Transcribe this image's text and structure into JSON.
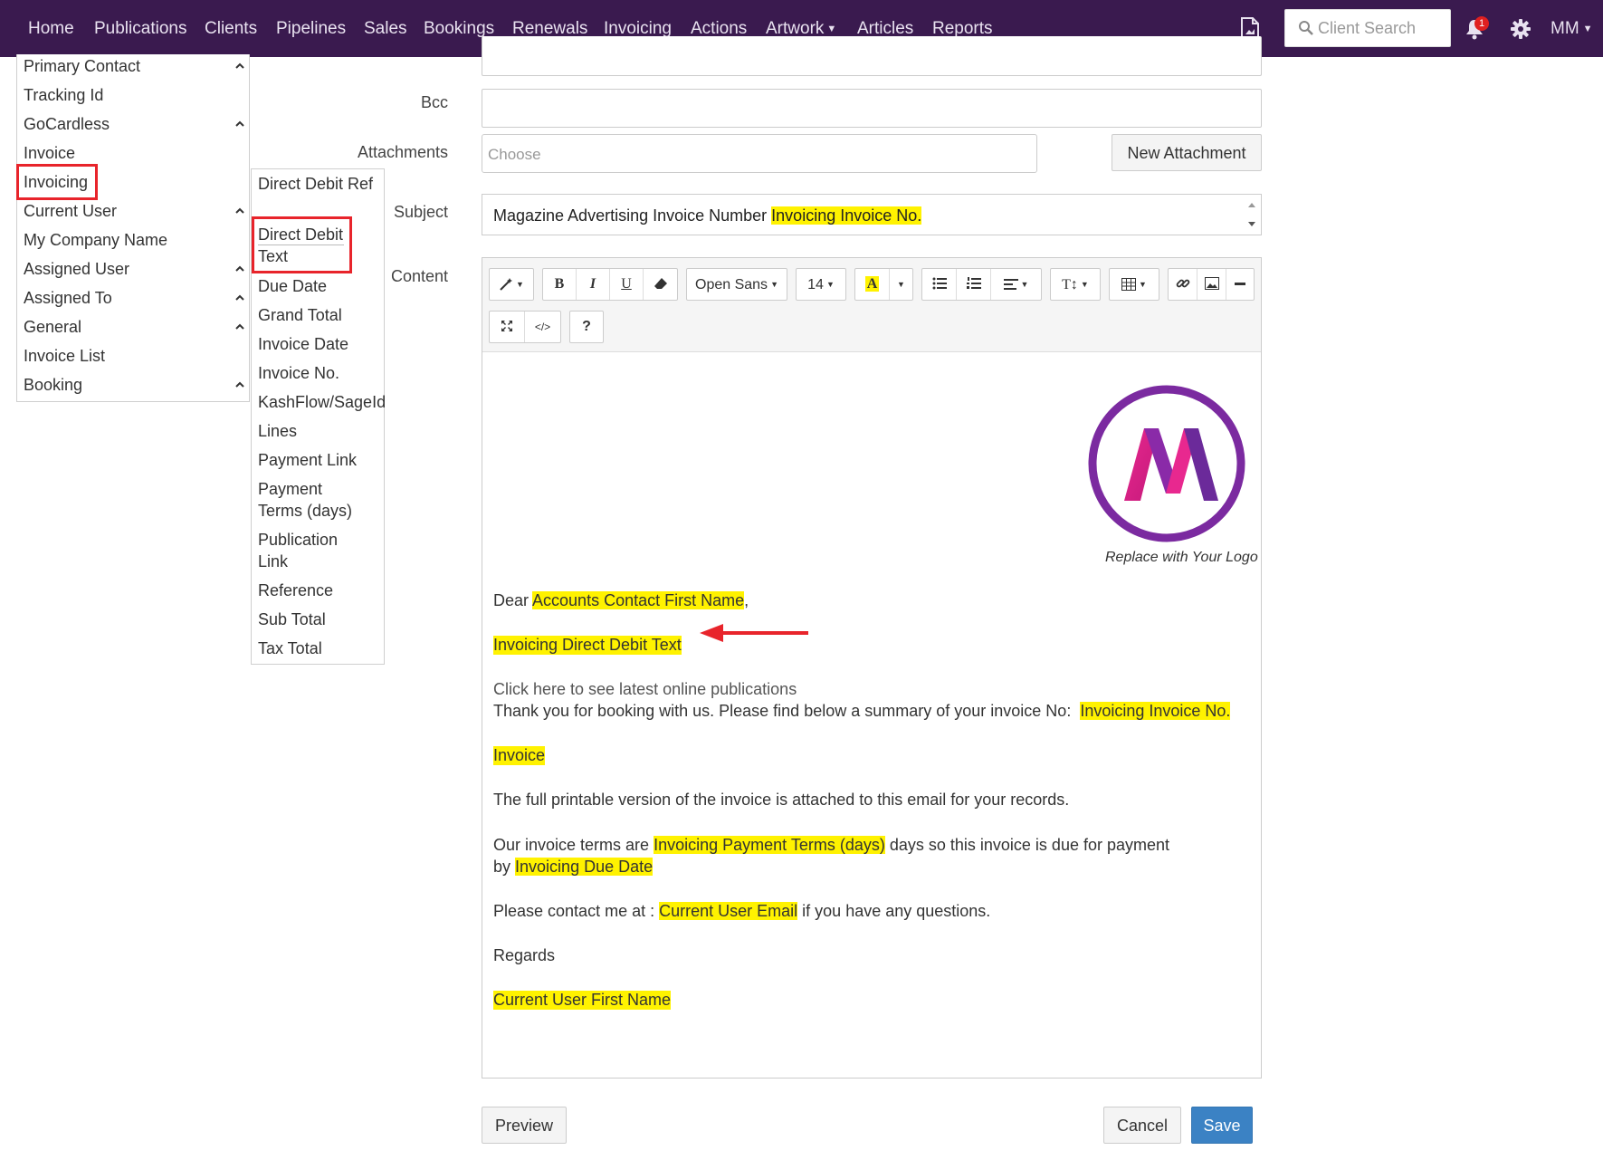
{
  "navbar": {
    "items": [
      "Home",
      "Publications",
      "Clients",
      "Pipelines",
      "Sales",
      "Bookings",
      "Renewals",
      "Invoicing",
      "Actions",
      "Artwork",
      "Articles",
      "Reports"
    ],
    "search_placeholder": "Client Search",
    "notification_count": "1",
    "user_initials": "MM",
    "icons": [
      "pdf-icon",
      "search-icon",
      "bell-icon",
      "gear-icon",
      "chevron-down-icon"
    ]
  },
  "left_menu": {
    "items": [
      "Primary Contact",
      "Tracking Id",
      "GoCardless",
      "Invoice",
      "Invoicing",
      "Current User",
      "My Company Name",
      "Assigned User",
      "Assigned To",
      "General",
      "Invoice List",
      "Booking"
    ],
    "highlighted": "Invoicing",
    "highlight_color": "#e8242b"
  },
  "sub_menu": {
    "items": [
      "Direct Debit Ref",
      "Direct Debit Text",
      "Due Date",
      "Grand Total",
      "Invoice Date",
      "Invoice No.",
      "KashFlow/SageId",
      "Lines",
      "Payment Link",
      "Payment Terms (days)",
      "Publication Link",
      "Reference",
      "Sub Total",
      "Tax Total"
    ],
    "highlighted": "Direct Debit Text"
  },
  "form": {
    "bcc_label": "Bcc",
    "attachments_label": "Attachments",
    "attachments_placeholder": "Choose",
    "new_attachment_label": "New Attachment",
    "subject_label": "Subject",
    "subject_text": "Magazine Advertising Invoice Number",
    "subject_token": "Invoicing Invoice No.",
    "content_label": "Content"
  },
  "toolbar": {
    "font_name": "Open Sans",
    "font_size": "14",
    "bold": "B",
    "italic": "I",
    "underline": "U",
    "text_color_glyph": "A",
    "text_height_glyph": "T↕",
    "help": "?"
  },
  "content": {
    "logo_caption": "Replace with Your Logo",
    "dear": "Dear",
    "dear_token": "Accounts Contact First Name",
    "dear_suffix": ",",
    "dd_token": "Invoicing Direct Debit Text",
    "link_text": "Click here to see latest online publications",
    "thanks": "Thank you for booking with us. Please find below a summary of your invoice No:",
    "thanks_token": "Invoicing Invoice No.",
    "invoice_token": "Invoice",
    "printable": "The full printable version of the invoice is attached to this email for your records.",
    "terms_prefix": "Our invoice terms are",
    "terms_token": "Invoicing Payment Terms (days)",
    "terms_suffix": "days so this invoice is due for payment",
    "by": "by",
    "due_token": "Invoicing Due Date",
    "contact_prefix": "Please contact me at :",
    "contact_token": "Current User Email",
    "contact_suffix": "if you have any questions.",
    "regards": "Regards",
    "signature_token": "Current User First Name",
    "highlight_color": "#fff200",
    "arrow_color": "#e8242b"
  },
  "footer": {
    "preview_label": "Preview",
    "cancel_label": "Cancel",
    "save_label": "Save"
  }
}
